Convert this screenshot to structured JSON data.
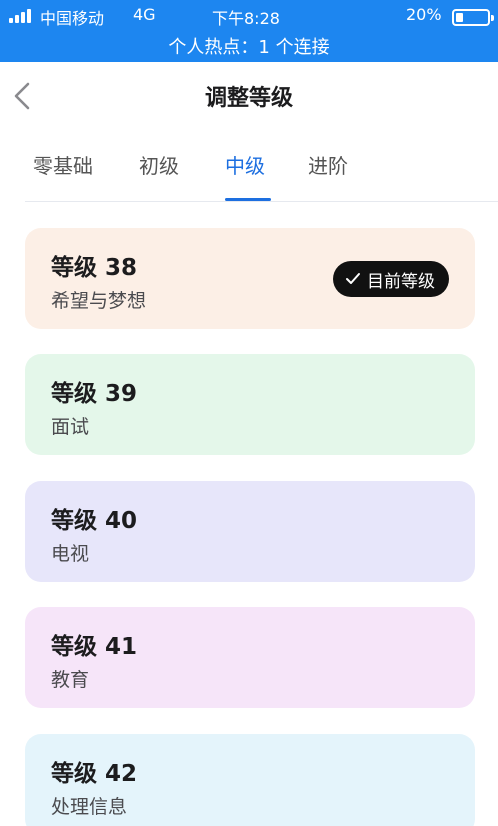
{
  "status_bar": {
    "carrier": "中国移动",
    "network": "4G",
    "time": "下午8:28",
    "battery": "20%",
    "battery_level": 0.2,
    "hotspot": "个人热点：1 个连接",
    "color": "#1d86f0"
  },
  "nav": {
    "back_icon": "chevron-left-icon",
    "title": "调整等级"
  },
  "tabs": [
    {
      "label": "零基础"
    },
    {
      "label": "初级"
    },
    {
      "label": "中级",
      "active": true
    },
    {
      "label": "进阶"
    }
  ],
  "current_badge": {
    "icon": "checkmark-icon",
    "label": "目前等级"
  },
  "levels": [
    {
      "title": "等级 38",
      "subtitle": "希望与梦想",
      "color": "#fcefe6",
      "current": true
    },
    {
      "title": "等级 39",
      "subtitle": "面试",
      "color": "#e4f7ea"
    },
    {
      "title": "等级 40",
      "subtitle": "电视",
      "color": "#e7e6fa"
    },
    {
      "title": "等级 41",
      "subtitle": "教育",
      "color": "#f6e5f9"
    },
    {
      "title": "等级 42",
      "subtitle": "处理信息",
      "color": "#e4f4fb"
    }
  ],
  "accent_color": "#1d6fe0"
}
